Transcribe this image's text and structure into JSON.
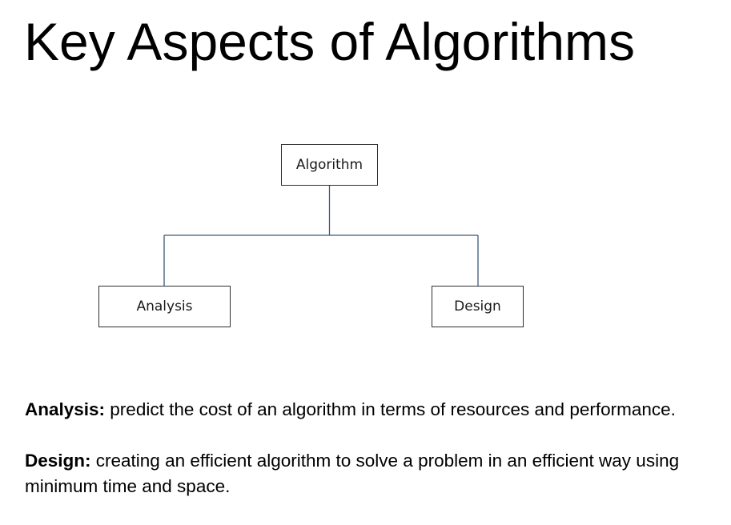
{
  "slide": {
    "title": "Key Aspects of Algorithms"
  },
  "diagram": {
    "root": "Algorithm",
    "children": [
      "Analysis",
      "Design"
    ],
    "connector_color": "#3b5a7a",
    "box_border_color": "#2f2f2f"
  },
  "definitions": [
    {
      "term": "Analysis:",
      "text": " predict the cost of an algorithm in terms of resources and performance."
    },
    {
      "term": "Design:",
      "text": " creating an efficient algorithm to solve a problem in an efficient way using minimum time and space."
    }
  ]
}
